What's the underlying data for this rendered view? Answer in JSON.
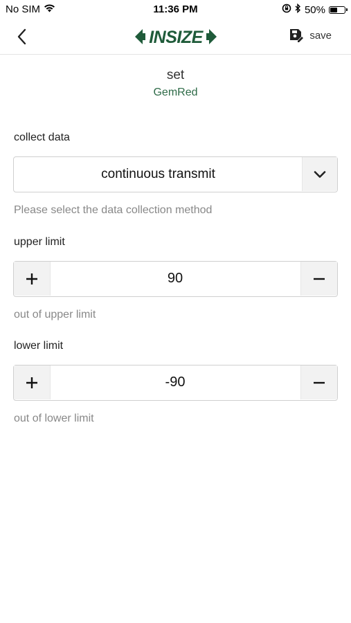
{
  "status_bar": {
    "carrier": "No SIM",
    "time": "11:36 PM",
    "battery": "50%",
    "battery_level": 0.5
  },
  "nav": {
    "logo_text": "INSIZE",
    "save_label": "save",
    "brand_color": "#1f5b3a"
  },
  "header": {
    "title": "set",
    "device": "GemRed"
  },
  "collect_data": {
    "label": "collect data",
    "selected": "continuous transmit",
    "hint": "Please select the data collection method"
  },
  "upper_limit": {
    "label": "upper limit",
    "value": "90",
    "hint": "out of upper limit"
  },
  "lower_limit": {
    "label": "lower limit",
    "value": "-90",
    "hint": "out of lower limit"
  }
}
